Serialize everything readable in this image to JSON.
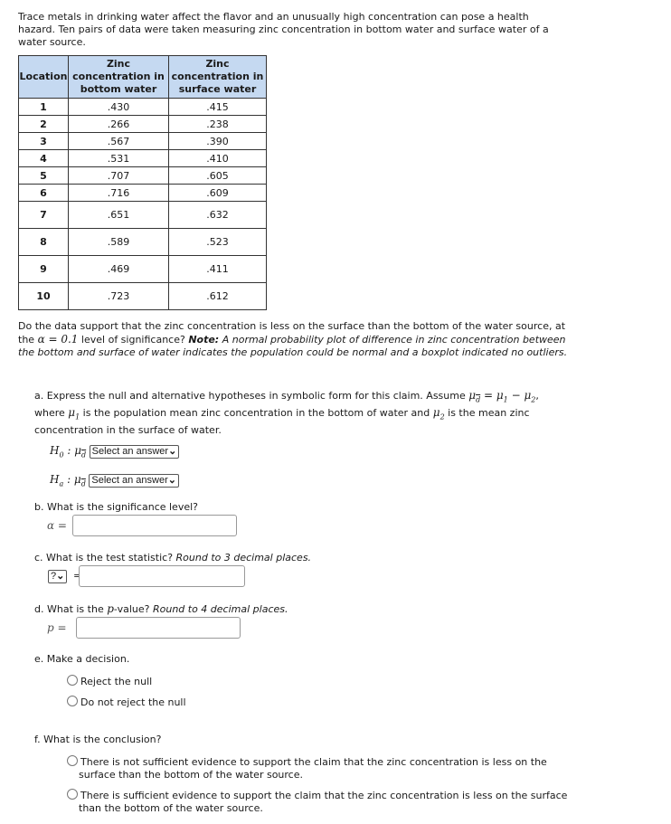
{
  "intro": "Trace metals in drinking water affect the flavor and an unusually high concentration can pose a health hazard. Ten pairs of data were taken measuring zinc concentration in bottom water and surface water of a water source.",
  "table": {
    "headers": [
      "Location",
      "Zinc concentration in bottom water",
      "Zinc concentration in surface water"
    ],
    "rows": [
      [
        "1",
        ".430",
        ".415"
      ],
      [
        "2",
        ".266",
        ".238"
      ],
      [
        "3",
        ".567",
        ".390"
      ],
      [
        "4",
        ".531",
        ".410"
      ],
      [
        "5",
        ".707",
        ".605"
      ],
      [
        "6",
        ".716",
        ".609"
      ],
      [
        "7",
        ".651",
        ".632"
      ],
      [
        "8",
        ".589",
        ".523"
      ],
      [
        "9",
        ".469",
        ".411"
      ],
      [
        "10",
        ".723",
        ".612"
      ]
    ]
  },
  "question": {
    "text1": "Do the data support that the zinc concentration is less on the surface than the bottom of the water source, at the ",
    "alpha_expr": "α = 0.1",
    "text2": " level of significance? ",
    "note_label": "Note:",
    "note": " A normal probability plot of difference in zinc concentration between the bottom and surface of water indicates the population could be normal and a boxplot indicated no outliers."
  },
  "part_a": {
    "t1": "a. Express the null and alternative hypotheses in symbolic form for this claim. Assume ",
    "mu_d": "μ",
    "eq": " = μ",
    "minus": " − μ",
    "t2": ", where ",
    "t3": " is the population mean zinc concentration in the bottom of water and ",
    "t4": " is the mean zinc concentration in the surface of water.",
    "h0": "H",
    "h0_sub": "0",
    "ha_sub": "a",
    "select_label": "Select an answer"
  },
  "part_b": {
    "label": "b. What is the significance level?",
    "symbol": "α ="
  },
  "part_c": {
    "label": "c. What is the test statistic? ",
    "hint": "Round to 3 decimal places.",
    "select_label": "?"
  },
  "part_d": {
    "label_pre": "d. What is the ",
    "p": "p",
    "label_post": "-value? ",
    "hint": "Round to 4 decimal places.",
    "symbol": "p ="
  },
  "part_e": {
    "label": "e. Make a decision.",
    "options": [
      "Reject the null",
      "Do not reject the null"
    ]
  },
  "part_f": {
    "label": "f. What is the conclusion?",
    "options": [
      "There is not sufficient evidence to support the claim that the zinc concentration is less on the surface than the bottom of the water source.",
      "There is sufficient evidence to support the claim that the zinc concentration is less on the surface than the bottom of the water source."
    ]
  }
}
